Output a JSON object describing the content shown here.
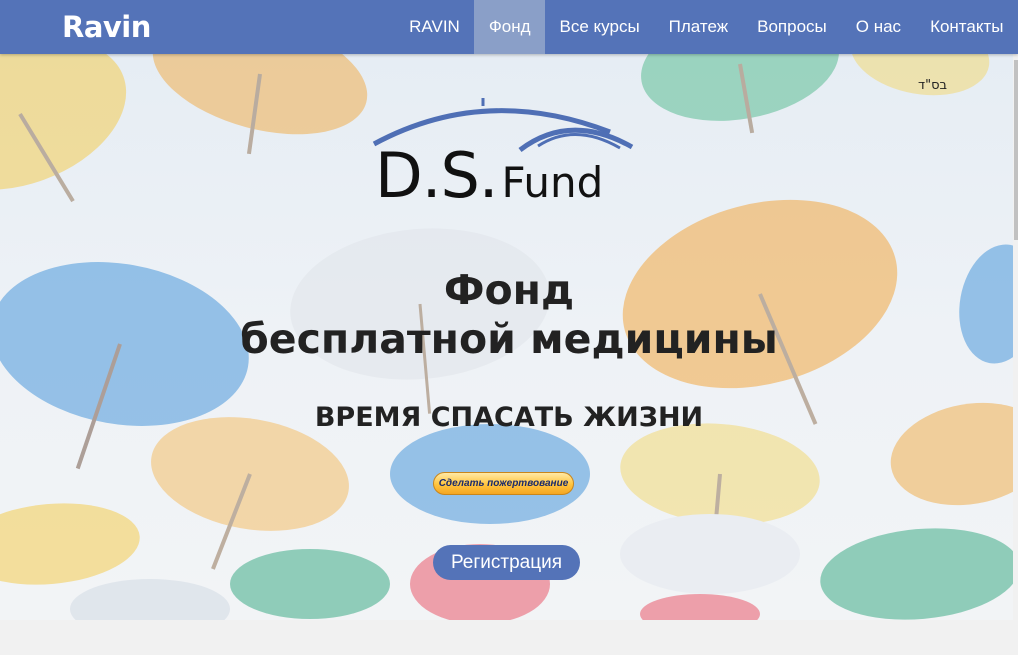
{
  "header": {
    "logo": "Ravin",
    "nav": [
      {
        "label": "RAVIN"
      },
      {
        "label": "Фонд",
        "active": true
      },
      {
        "label": "Все курсы"
      },
      {
        "label": "Платеж"
      },
      {
        "label": "Вопросы"
      },
      {
        "label": "О нас"
      },
      {
        "label": "Контакты"
      }
    ]
  },
  "hero": {
    "bsd": "בס\"ד",
    "fund_logo": {
      "big": "D.S.",
      "small": "Fund",
      "arc_color": "#4f6fb5"
    },
    "title_line1": "Фонд",
    "title_line2": "бесплатной медицины",
    "subtitle": "ВРЕМЯ СПАСАТЬ ЖИЗНИ",
    "donate_button": "Сделать пожертвование",
    "register_button": "Регистрация"
  },
  "colors": {
    "navbar": "#5473b8",
    "nav_active": "#8a9fc8",
    "button": "#5473b8",
    "page_bg": "#f1f1f1"
  },
  "icons": {
    "background": "umbrellas-photo"
  }
}
